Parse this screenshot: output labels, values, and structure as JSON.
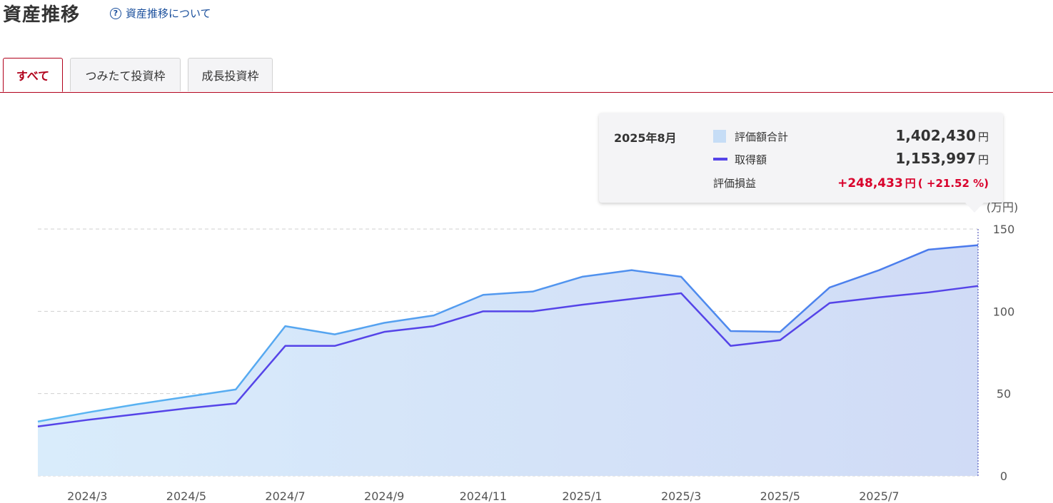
{
  "page": {
    "title": "資産推移",
    "help_link": "資産推移について",
    "help_icon": "question-circle-icon"
  },
  "tabs": [
    {
      "label": "すべて",
      "active": true
    },
    {
      "label": "つみたて投資枠",
      "active": false
    },
    {
      "label": "成長投資枠",
      "active": false
    }
  ],
  "tooltip": {
    "date": "2025年8月",
    "rows": [
      {
        "label": "評価額合計",
        "value": "1,402,430",
        "unit": "円"
      },
      {
        "label": "取得額",
        "value": "1,153,997",
        "unit": "円"
      },
      {
        "label": "評価損益",
        "value": "+248,433",
        "unit": "円",
        "pct": "( +21.52 %)"
      }
    ]
  },
  "colors": {
    "accent": "#b1001b",
    "valuation_line": "#4f8ff0",
    "cost_line": "#5544e8",
    "fill": "#d3e4f8",
    "gain": "#d9002b"
  },
  "chart_data": {
    "type": "area",
    "unit_label": "(万円)",
    "x": [
      "2024/2",
      "2024/3",
      "2024/4",
      "2024/5",
      "2024/6",
      "2024/7",
      "2024/8",
      "2024/9",
      "2024/10",
      "2024/11",
      "2024/12",
      "2025/1",
      "2025/2",
      "2025/3",
      "2025/4",
      "2025/5",
      "2025/6",
      "2025/7",
      "2025/8"
    ],
    "x_tick_labels": [
      "2024/3",
      "2024/5",
      "2024/7",
      "2024/9",
      "2024/11",
      "2025/1",
      "2025/3",
      "2025/5",
      "2025/7"
    ],
    "y_ticks": [
      0,
      50,
      100,
      150
    ],
    "ylim": [
      0,
      150
    ],
    "grid": true,
    "series": [
      {
        "name": "評価額合計",
        "type": "area",
        "values": [
          33,
          38.5,
          43.5,
          48,
          52.5,
          91,
          86,
          93,
          97.5,
          110,
          112,
          121,
          125,
          121,
          88,
          87.5,
          114.5,
          125,
          137.5,
          140.2
        ]
      },
      {
        "name": "取得額",
        "type": "line",
        "values": [
          30,
          34,
          37.5,
          41,
          44,
          79,
          79,
          87.5,
          91,
          100,
          100,
          104,
          107.5,
          111,
          79,
          82.5,
          105,
          108.5,
          111.5,
          115.4
        ]
      }
    ]
  }
}
